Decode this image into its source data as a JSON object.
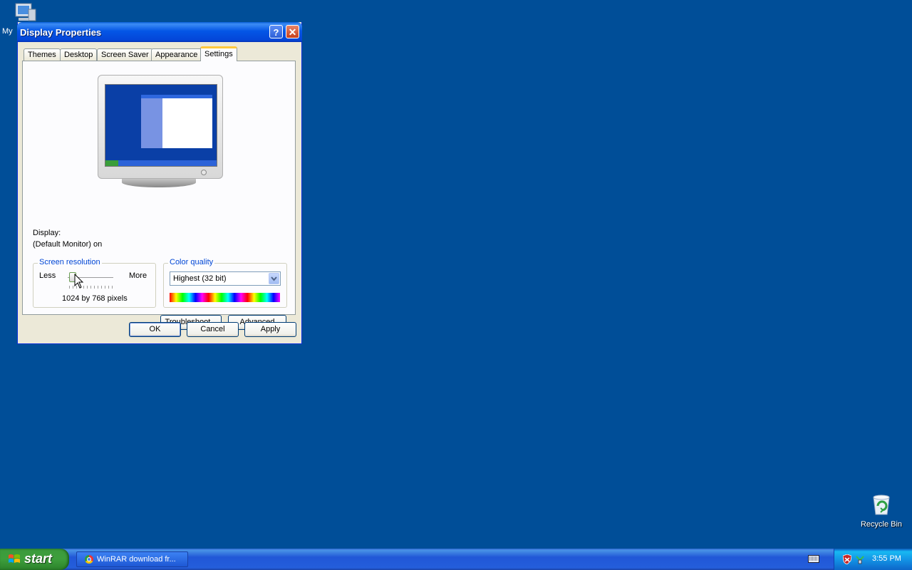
{
  "desktop": {
    "my_computer_label": "My",
    "recycle_bin_label": "Recycle Bin"
  },
  "window": {
    "title": "Display Properties",
    "help_glyph": "?",
    "close_glyph": "✕",
    "tabs": [
      {
        "label": "Themes"
      },
      {
        "label": "Desktop"
      },
      {
        "label": "Screen Saver"
      },
      {
        "label": "Appearance"
      },
      {
        "label": "Settings"
      }
    ],
    "active_tab": "Settings",
    "display_label": "Display:",
    "display_value": "(Default Monitor) on",
    "resolution": {
      "group_title": "Screen resolution",
      "less_label": "Less",
      "more_label": "More",
      "value_text": "1024 by 768 pixels"
    },
    "color_quality": {
      "group_title": "Color quality",
      "selected": "Highest (32 bit)"
    },
    "buttons": {
      "troubleshoot": "Troubleshoot...",
      "advanced": "Advanced",
      "ok": "OK",
      "cancel": "Cancel",
      "apply": "Apply"
    }
  },
  "taskbar": {
    "start_label": "start",
    "task_label": "WinRAR download fr...",
    "clock": "3:55 PM"
  },
  "colors": {
    "desktop_bg": "#004e98",
    "titlebar": "#0456e6",
    "start_green": "#3d9e3c",
    "group_title_blue": "#0046d5"
  }
}
